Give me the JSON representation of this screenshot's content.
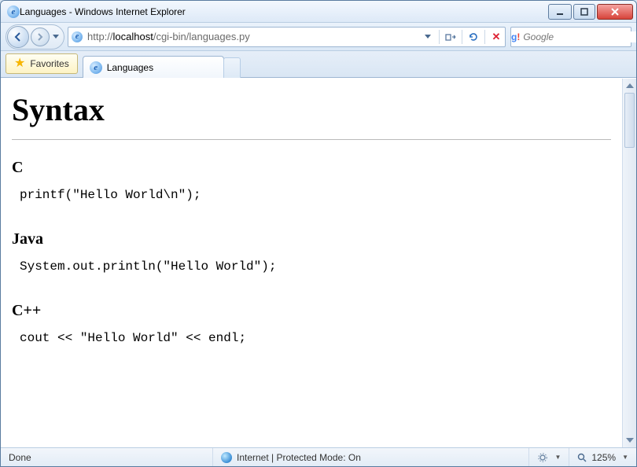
{
  "window": {
    "title": "Languages - Windows Internet Explorer"
  },
  "address": {
    "url_display": "http://localhost/cgi-bin/languages.py",
    "url_prefix": "http://",
    "url_host": "localhost",
    "url_path": "/cgi-bin/languages.py"
  },
  "search": {
    "placeholder": "Google"
  },
  "favorites": {
    "label": "Favorites"
  },
  "tabs": [
    {
      "label": "Languages"
    }
  ],
  "page": {
    "heading": "Syntax",
    "sections": [
      {
        "title": "C",
        "code": "printf(\"Hello World\\n\");"
      },
      {
        "title": "Java",
        "code": "System.out.println(\"Hello World\");"
      },
      {
        "title": "C++",
        "code": "cout << \"Hello World\" << endl;"
      }
    ]
  },
  "status": {
    "left": "Done",
    "zone": "Internet | Protected Mode: On",
    "zoom": "125%"
  }
}
